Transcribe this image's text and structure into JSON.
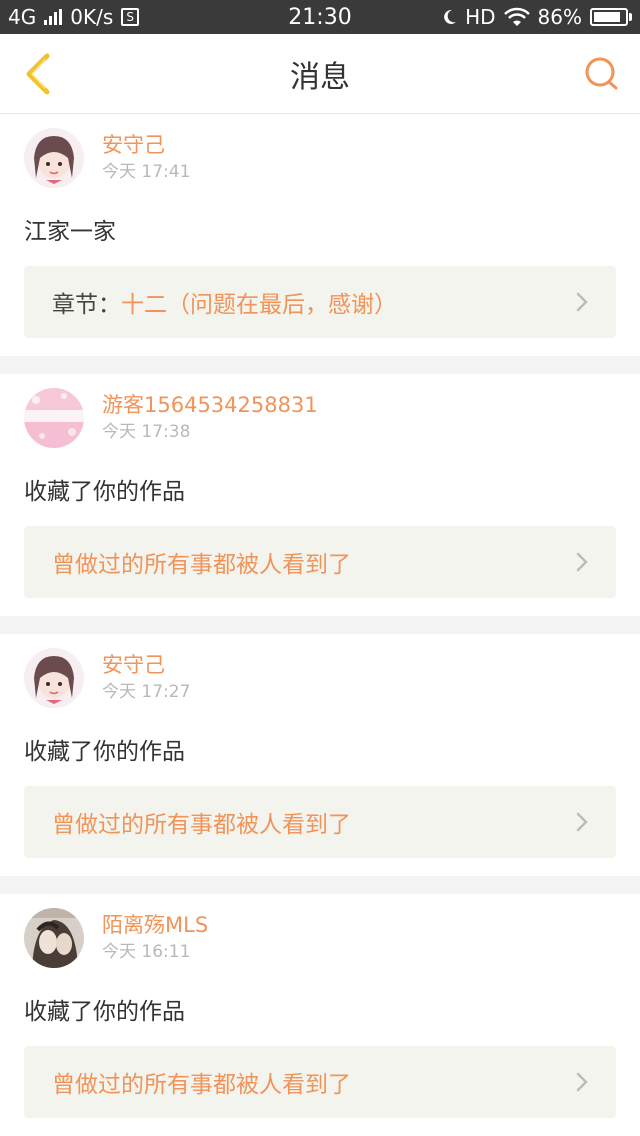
{
  "status_bar": {
    "network": "4G",
    "speed": "0K/s",
    "s_badge": "S",
    "time": "21:30",
    "hd": "HD",
    "battery_percent": "86%",
    "battery_level": 0.86
  },
  "header": {
    "title": "消息",
    "back_icon": "back-chevron-icon",
    "search_icon": "search-icon"
  },
  "colors": {
    "accent": "#f0945a",
    "back_icon": "#f2c12e",
    "card_box": "#f4f4ee"
  },
  "messages": [
    {
      "username": "安守己",
      "time": "今天 17:41",
      "text": "江家一家",
      "ref_prefix": "章节：",
      "ref_text": "十二（问题在最后，感谢）"
    },
    {
      "username": "游客1564534258831",
      "time": "今天 17:38",
      "text": "收藏了你的作品",
      "ref_prefix": "",
      "ref_text": "曾做过的所有事都被人看到了"
    },
    {
      "username": "安守己",
      "time": "今天 17:27",
      "text": "收藏了你的作品",
      "ref_prefix": "",
      "ref_text": "曾做过的所有事都被人看到了"
    },
    {
      "username": "陌离殇MLS",
      "time": "今天 16:11",
      "text": "收藏了你的作品",
      "ref_prefix": "",
      "ref_text": "曾做过的所有事都被人看到了"
    }
  ]
}
